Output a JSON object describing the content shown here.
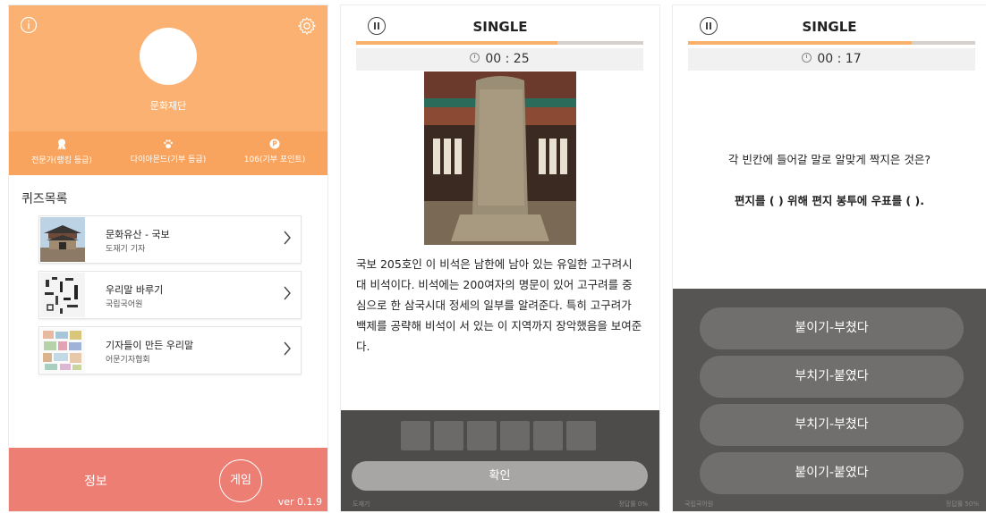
{
  "screen1": {
    "username": "문화재단",
    "stats": [
      {
        "icon": "medal-icon",
        "label": "전문가(랭킹 등급)"
      },
      {
        "icon": "paw-icon",
        "label": "다이아몬드(기부 등급)"
      },
      {
        "icon": "point-icon",
        "label": "106(기부 포인트)",
        "badge": "P"
      }
    ],
    "quiz_list_title": "퀴즈목록",
    "quiz_items": [
      {
        "name": "문화유산 - 국보",
        "author": "도재기 기자"
      },
      {
        "name": "우리말 바루기",
        "author": "국립국어원"
      },
      {
        "name": "기자들이 만든 우리말",
        "author": "어문기자협회"
      }
    ],
    "footer": {
      "info_label": "정보",
      "game_label": "게임",
      "version": "ver 0.1.9"
    }
  },
  "screen2": {
    "mode": "SINGLE",
    "progress": 0.7,
    "timer": "00 : 25",
    "description": "국보 205호인 이 비석은 남한에 남아 있는 유일한 고구려시대 비석이다. 비석에는 200여자의 명문이 있어 고구려를 중심으로 한 삼국시대 정세의 일부를 알려준다. 특히 고구려가 백제를 공략해 비석이 서 있는 이 지역까지 장악했음을 보여준다.",
    "answer_slots": 6,
    "confirm_label": "확인",
    "credit": "도재기",
    "accuracy": "정답률 0%"
  },
  "screen3": {
    "mode": "SINGLE",
    "progress": 0.78,
    "timer": "00 : 17",
    "question": "각 빈칸에 들어갈 말로 알맞게 짝지은 것은?",
    "sentence": "편지를 ( ) 위해 편지 봉투에 우표를 ( ).",
    "options": [
      "붙이기-부쳤다",
      "부치기-붙였다",
      "부치기-부쳤다",
      "붙이기-붙였다"
    ],
    "credit": "국립국어원",
    "accuracy": "정답률 50%"
  },
  "colors": {
    "header_orange": "#fbb171",
    "footer_coral": "#ed7e74",
    "progress_orange": "#f8b06a",
    "dark_panel": "#4e4c4a"
  }
}
